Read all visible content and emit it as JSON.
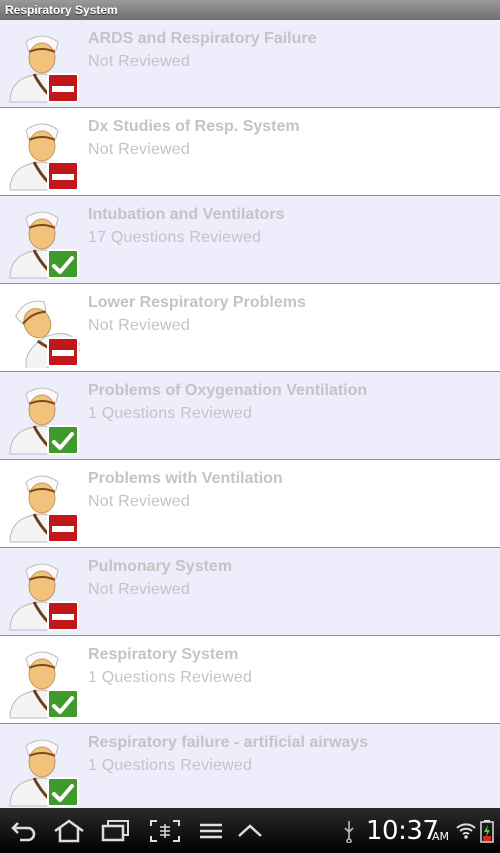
{
  "window": {
    "title": "Respiratory System"
  },
  "topics": [
    {
      "title": "ARDS and Respiratory Failure",
      "status": "Not Reviewed",
      "state": "not-reviewed"
    },
    {
      "title": "Dx Studies of Resp. System",
      "status": "Not Reviewed",
      "state": "not-reviewed"
    },
    {
      "title": "Intubation and Ventilators",
      "status": "17 Questions Reviewed",
      "state": "reviewed"
    },
    {
      "title": "Lower Respiratory Problems",
      "status": "Not Reviewed",
      "state": "not-reviewed"
    },
    {
      "title": "Problems of Oxygenation Ventilation",
      "status": "1 Questions Reviewed",
      "state": "reviewed"
    },
    {
      "title": "Problems with Ventilation",
      "status": "Not Reviewed",
      "state": "not-reviewed"
    },
    {
      "title": "Pulmonary System",
      "status": "Not Reviewed",
      "state": "not-reviewed"
    },
    {
      "title": "Respiratory System",
      "status": "1 Questions Reviewed",
      "state": "reviewed"
    },
    {
      "title": "Respiratory failure - artificial airways",
      "status": "1 Questions Reviewed",
      "state": "reviewed"
    }
  ],
  "status_bar": {
    "time": "10:37",
    "ampm": "AM"
  },
  "nav_icons": [
    "back-icon",
    "home-icon",
    "recent-apps-icon",
    "screenshot-icon",
    "menu-icon",
    "up-arrow-icon",
    "usb-icon",
    "wifi-icon",
    "battery-icon"
  ],
  "colors": {
    "reviewed_badge": "#3f9a2c",
    "not_reviewed_badge": "#c0171b",
    "odd_row": "#ededfb",
    "even_row": "#ffffff",
    "text_muted": "#c4c4c4"
  }
}
